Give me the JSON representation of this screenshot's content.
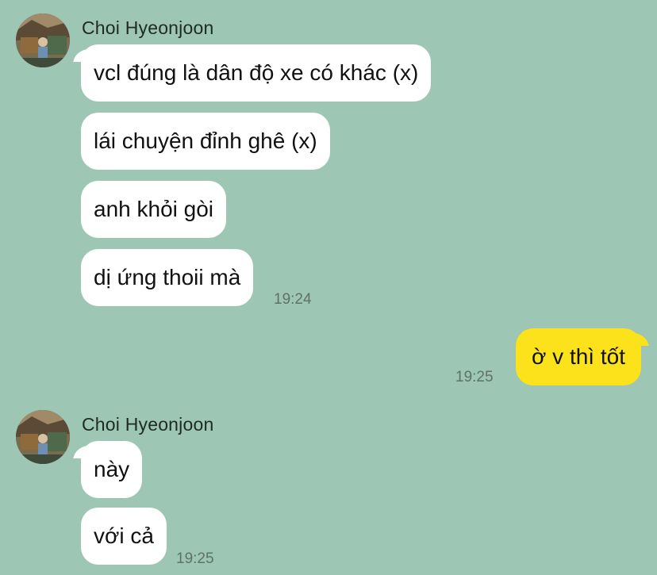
{
  "groups": [
    {
      "sender": "Choi Hyeonjoon",
      "messages": [
        "vcl đúng là dân độ xe có khác (x)",
        "lái chuyện đỉnh ghê (x)",
        "anh khỏi gòi",
        "dị ứng thoii mà"
      ],
      "time": "19:24"
    },
    {
      "sender": "Choi Hyeonjoon",
      "messages": [
        "này",
        "với cả"
      ],
      "time": "19:25"
    }
  ],
  "outgoing": {
    "message": "ờ v thì tốt",
    "time": "19:25"
  },
  "colors": {
    "background": "#9dc6b4",
    "incoming_bubble": "#ffffff",
    "outgoing_bubble": "#fbe21a"
  }
}
